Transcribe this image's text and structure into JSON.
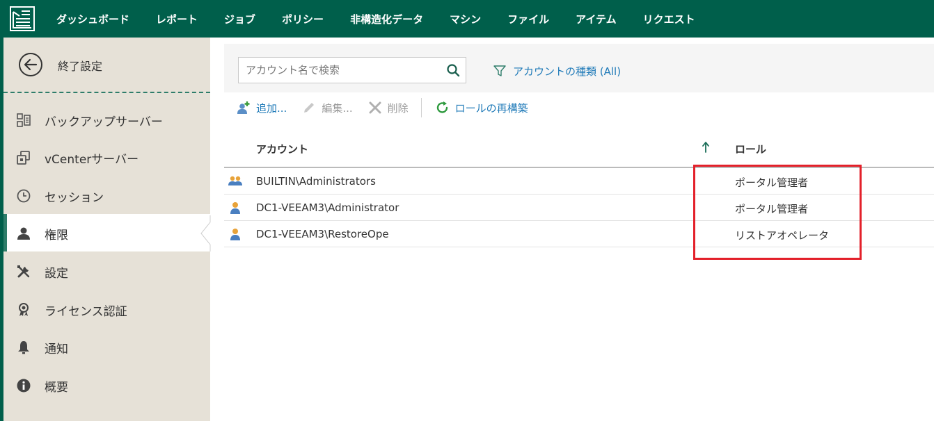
{
  "nav": {
    "items": [
      "ダッシュボード",
      "レポート",
      "ジョブ",
      "ポリシー",
      "非構造化データ",
      "マシン",
      "ファイル",
      "アイテム",
      "リクエスト"
    ]
  },
  "sidebar": {
    "exit_label": "終了設定",
    "items": [
      {
        "label": "バックアップサーバー",
        "icon": "server-icon"
      },
      {
        "label": "vCenterサーバー",
        "icon": "vcenter-icon"
      },
      {
        "label": "セッション",
        "icon": "clock-icon"
      },
      {
        "label": "権限",
        "icon": "user-icon"
      },
      {
        "label": "設定",
        "icon": "tools-icon"
      },
      {
        "label": "ライセンス認証",
        "icon": "license-icon"
      },
      {
        "label": "通知",
        "icon": "bell-icon"
      },
      {
        "label": "概要",
        "icon": "info-icon"
      }
    ],
    "active_index": 3
  },
  "search": {
    "placeholder": "アカウント名で検索",
    "filter_label": "アカウントの種類 (All)"
  },
  "toolbar": {
    "add_label": "追加...",
    "edit_label": "編集...",
    "delete_label": "削除",
    "rebuild_label": "ロールの再構築"
  },
  "table": {
    "headers": {
      "account": "アカウント",
      "role": "ロール"
    },
    "rows": [
      {
        "account": "BUILTIN\\Administrators",
        "role": "ポータル管理者",
        "type": "group"
      },
      {
        "account": "DC1-VEEAM3\\Administrator",
        "role": "ポータル管理者",
        "type": "user"
      },
      {
        "account": "DC1-VEEAM3\\RestoreOpe",
        "role": "リストアオペレータ",
        "type": "user"
      }
    ]
  },
  "colors": {
    "brand": "#005f4b",
    "accent": "#1f7ab8",
    "highlight": "#e3202a"
  }
}
